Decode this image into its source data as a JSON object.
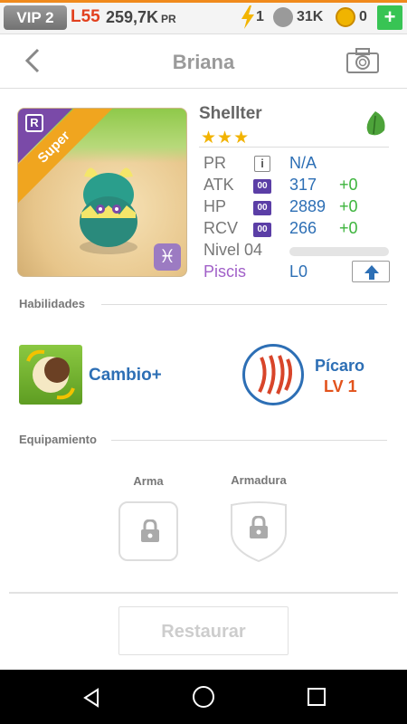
{
  "status": {
    "vip": "VIP 2",
    "level": "L55",
    "power": "259,7K",
    "power_unit": "PR",
    "energy": "1",
    "paws": "31K",
    "coins": "0",
    "plus_icon": "+"
  },
  "header": {
    "title": "Briana"
  },
  "monster": {
    "name": "Shellter",
    "stars": "★★★",
    "rarity_badge": "R",
    "rank_ribbon": "Super",
    "zodiac_glyph": "♓",
    "stats": [
      {
        "label": "PR",
        "value": "N/A",
        "bonus": ""
      },
      {
        "label": "ATK",
        "value": "317",
        "bonus": "+0",
        "badge": "00"
      },
      {
        "label": "HP",
        "value": "2889",
        "bonus": "+0",
        "badge": "00"
      },
      {
        "label": "RCV",
        "value": "266",
        "bonus": "+0",
        "badge": "00"
      }
    ],
    "level_label": "Nivel 04",
    "level_progress": 0,
    "sign_label": "Piscis",
    "sign_level": "L0",
    "info_icon": "i"
  },
  "skills": {
    "section_title": "Habilidades",
    "skill1": {
      "label": "Cambio+"
    },
    "skill2": {
      "label": "Pícaro",
      "level": "LV 1"
    }
  },
  "equipment": {
    "section_title": "Equipamiento",
    "weapon_label": "Arma",
    "armor_label": "Armadura"
  },
  "actions": {
    "restore_label": "Restaurar"
  },
  "colors": {
    "accent_blue": "#2d6fb5",
    "bonus_green": "#3cb43c",
    "orange": "#f08a1c",
    "purple_sign": "#a160c8"
  }
}
